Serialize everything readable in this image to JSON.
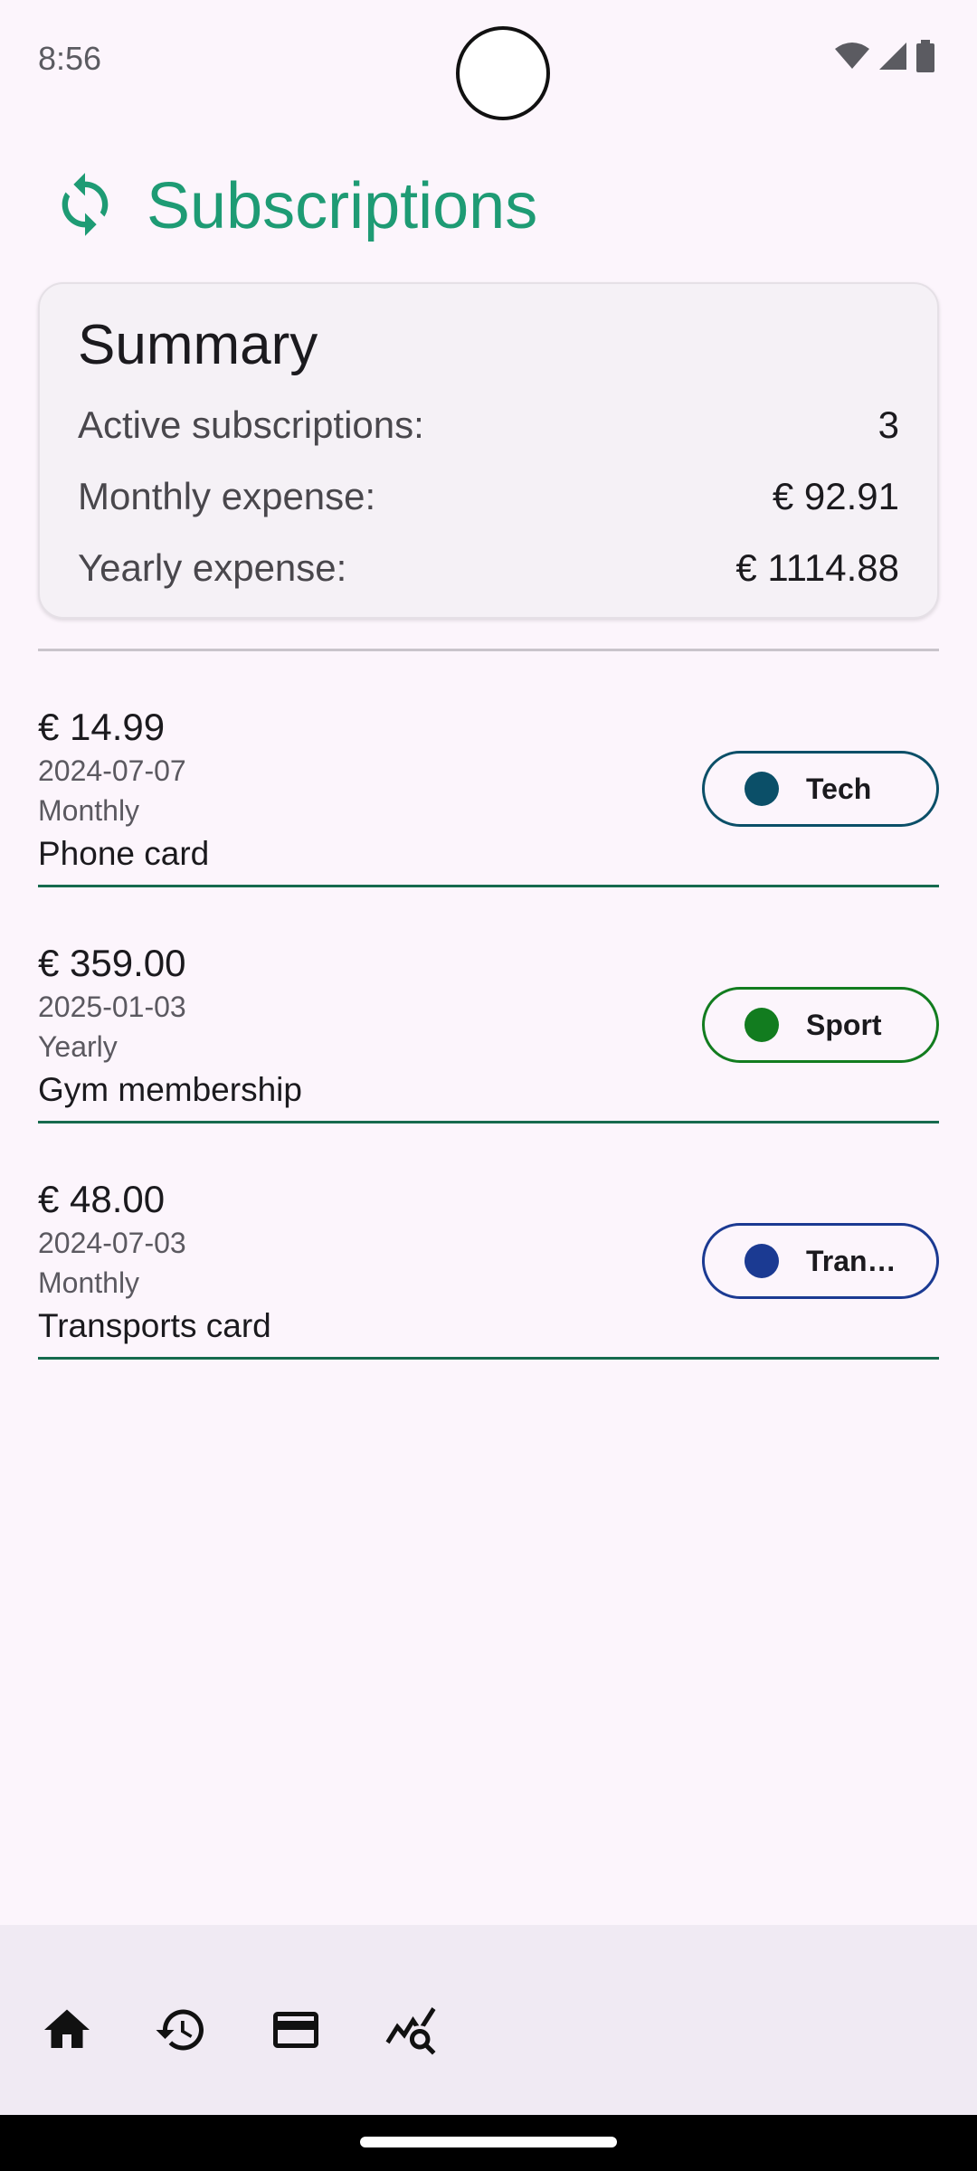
{
  "status_bar": {
    "time": "8:56",
    "icons": [
      "wifi-icon",
      "signal-icon",
      "battery-icon"
    ]
  },
  "header": {
    "icon": "sync-icon",
    "title": "Subscriptions",
    "accent": "#1E9B74"
  },
  "summary": {
    "title": "Summary",
    "rows": [
      {
        "label": "Active subscriptions:",
        "value": "3"
      },
      {
        "label": "Monthly expense:",
        "value": "€ 92.91"
      },
      {
        "label": "Yearly expense:",
        "value": "€ 1114.88"
      }
    ]
  },
  "subscriptions": [
    {
      "price": "€ 14.99",
      "date": "2024-07-07",
      "frequency": "Monthly",
      "name": "Phone card",
      "category": "Tech",
      "category_color": "#0B4F68"
    },
    {
      "price": "€ 359.00",
      "date": "2025-01-03",
      "frequency": "Yearly",
      "name": "Gym membership",
      "category": "Sport",
      "category_color": "#127C1F"
    },
    {
      "price": "€ 48.00",
      "date": "2024-07-03",
      "frequency": "Monthly",
      "name": "Transports card",
      "category": "Tran…",
      "category_color": "#1B3A92"
    }
  ],
  "bottom_nav": {
    "items": [
      "home-icon",
      "history-icon",
      "credit-card-icon",
      "query-stats-icon"
    ]
  }
}
